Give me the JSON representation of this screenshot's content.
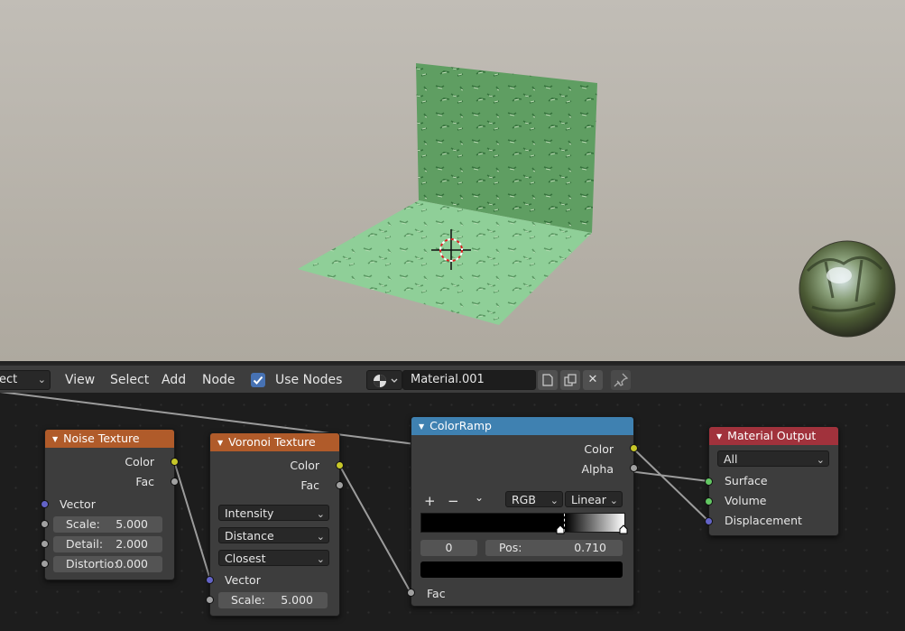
{
  "header": {
    "mode_select": "ect",
    "menus": [
      "View",
      "Select",
      "Add",
      "Node"
    ],
    "use_nodes_label": "Use Nodes",
    "use_nodes_checked": true,
    "material_name": "Material.001"
  },
  "nodes": {
    "noise": {
      "title": "Noise Texture",
      "out_color": "Color",
      "out_fac": "Fac",
      "in_vector": "Vector",
      "scale_label": "Scale:",
      "scale_value": "5.000",
      "detail_label": "Detail:",
      "detail_value": "2.000",
      "distortion_label": "Distortio:",
      "distortion_value": "0.000",
      "header_color": "#b05b2a"
    },
    "voronoi": {
      "title": "Voronoi Texture",
      "out_color": "Color",
      "out_fac": "Fac",
      "opt1": "Intensity",
      "opt2": "Distance",
      "opt3": "Closest",
      "in_vector": "Vector",
      "scale_label": "Scale:",
      "scale_value": "5.000",
      "header_color": "#b05b2a"
    },
    "colorramp": {
      "title": "ColorRamp",
      "out_color": "Color",
      "out_alpha": "Alpha",
      "add_symbol": "+",
      "remove_symbol": "−",
      "color_mode": "RGB",
      "interpolation": "Linear",
      "stop_index": "0",
      "pos_label": "Pos:",
      "pos_value": "0.710",
      "in_fac": "Fac",
      "header_color": "#3f81b1"
    },
    "output": {
      "title": "Material Output",
      "target": "All",
      "in_surface": "Surface",
      "in_volume": "Volume",
      "in_displacement": "Displacement",
      "header_color": "#a1323c"
    }
  },
  "icons": [
    "chevron-down-icon",
    "checkbox-icon",
    "material-sphere-icon",
    "browse-icon",
    "duplicate-icon",
    "close-icon",
    "pin-icon"
  ],
  "socket_colors": {
    "color": "#c7c729",
    "float": "#a1a1a1",
    "vector": "#6363c7",
    "shader": "#63c763"
  }
}
